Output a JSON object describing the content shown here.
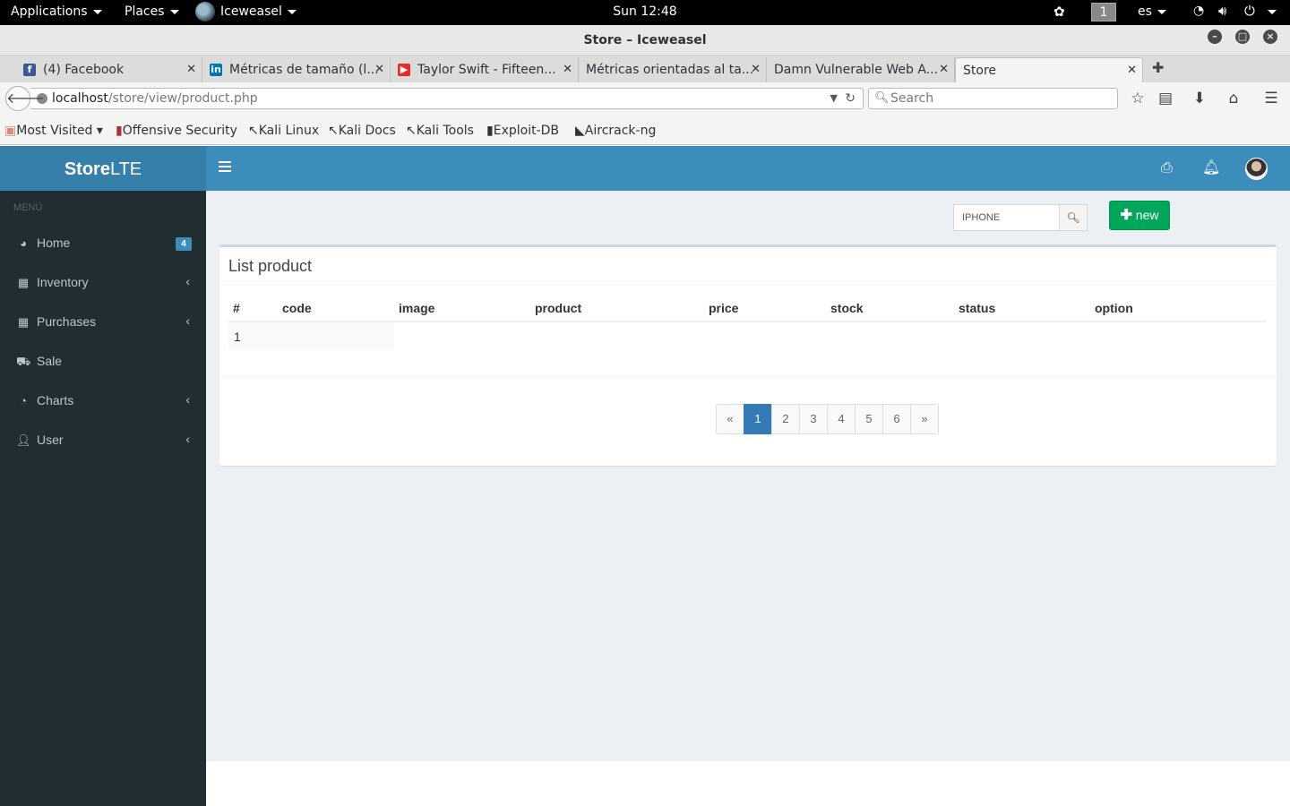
{
  "topbar": {
    "applications": "Applications",
    "places": "Places",
    "browser": "Iceweasel",
    "clock": "Sun 12:48",
    "workspace": "1",
    "lang": "es"
  },
  "window": {
    "title": "Store – Iceweasel"
  },
  "tabs": [
    {
      "label": "(4) Facebook",
      "favicon": "facebook-icon",
      "color": "#3b5998"
    },
    {
      "label": "Métricas de tamaño (l...",
      "favicon": "linkedin-icon",
      "color": "#0077b5"
    },
    {
      "label": "Taylor Swift - Fifteen...",
      "favicon": "youtube-icon",
      "color": "#e52d27"
    },
    {
      "label": "Métricas orientadas al ta..."
    },
    {
      "label": "Damn Vulnerable Web A..."
    },
    {
      "label": "Store",
      "active": true
    }
  ],
  "navbar": {
    "url_host": "localhost",
    "url_path": "/store/view/product.php",
    "search_placeholder": "Search"
  },
  "bookmarks": [
    "Most Visited",
    "Offensive Security",
    "Kali Linux",
    "Kali Docs",
    "Kali Tools",
    "Exploit-DB",
    "Aircrack-ng"
  ],
  "app": {
    "logo_bold": "Store",
    "logo_rest": "LTE",
    "menu_header": "MENÚ",
    "menu": [
      {
        "label": "Home",
        "icon": "dashboard-icon",
        "badge": "4"
      },
      {
        "label": "Inventory",
        "icon": "grid-icon"
      },
      {
        "label": "Purchases",
        "icon": "grid-icon"
      },
      {
        "label": "Sale",
        "icon": "cart-icon"
      },
      {
        "label": "Charts",
        "icon": "pie-chart-icon"
      },
      {
        "label": "User",
        "icon": "user-icon"
      }
    ],
    "search_value": "IPHONE",
    "new_label": "new",
    "box_title": "List product",
    "columns": [
      "#",
      "code",
      "image",
      "product",
      "price",
      "stock",
      "status",
      "option"
    ],
    "rows": [
      [
        "1",
        "",
        "",
        "",
        "",
        "",
        "",
        ""
      ]
    ],
    "pagination": [
      "«",
      "1",
      "2",
      "3",
      "4",
      "5",
      "6",
      "»"
    ],
    "active_page": "1"
  }
}
